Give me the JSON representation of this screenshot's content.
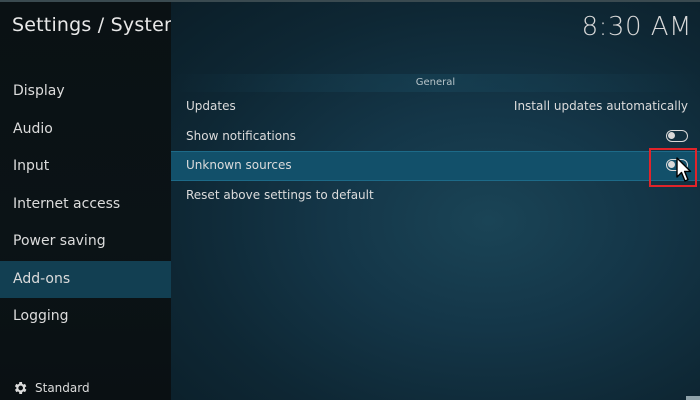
{
  "header": {
    "title": "Settings / System",
    "clock": "8:30 AM"
  },
  "sidebar": {
    "items": [
      {
        "label": "Display"
      },
      {
        "label": "Audio"
      },
      {
        "label": "Input"
      },
      {
        "label": "Internet access"
      },
      {
        "label": "Power saving"
      },
      {
        "label": "Add-ons",
        "active": true
      },
      {
        "label": "Logging"
      }
    ],
    "footer": {
      "icon": "gear-icon",
      "label": "Standard"
    }
  },
  "main": {
    "section_header": "General",
    "settings": [
      {
        "label": "Updates",
        "value": "Install updates automatically"
      },
      {
        "label": "Show notifications",
        "toggle": "off"
      },
      {
        "label": "Unknown sources",
        "toggle": "off",
        "focused": true
      },
      {
        "label": "Reset above settings to default"
      }
    ]
  },
  "colors": {
    "background": "#0d1518",
    "active_item": "#123f52",
    "focused_row": "#12506a",
    "highlight_box": "#e0242a"
  }
}
